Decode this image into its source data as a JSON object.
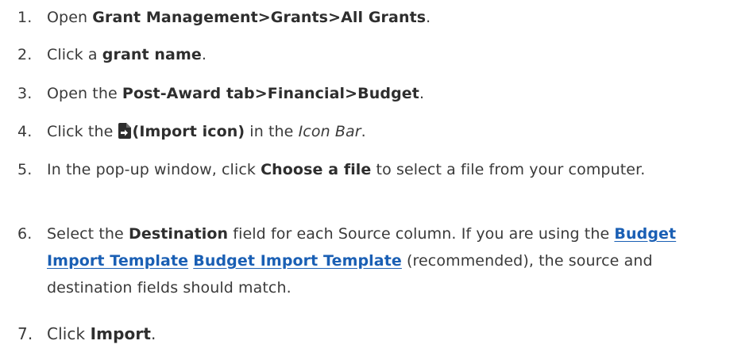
{
  "steps": [
    {
      "number": "1.",
      "pre": "Open ",
      "bold": "Grant Management>Grants>All Grants",
      "post": "."
    },
    {
      "number": "2.",
      "pre": "Click a ",
      "bold": "grant name",
      "post": "."
    },
    {
      "number": "3.",
      "pre": "Open the ",
      "bold": "Post-Award tab>Financial>Budget",
      "post": "."
    },
    {
      "number": "4.",
      "pre": "Click the ",
      "icon": "import-file-icon",
      "bold": "(Import icon)",
      "mid": " in the ",
      "italic": "Icon Bar",
      "post": "."
    },
    {
      "number": "5.",
      "pre": "In the pop-up window, click ",
      "bold": "Choose a file",
      "post": " to select a file from your computer."
    },
    {
      "number": "6.",
      "pre": "Select the ",
      "bold": "Destination",
      "mid": " field for each Source column. If you are using the ",
      "link1": "Budget Import Template",
      "link2": "Budget Import Template",
      "post": " (recommended), the source and destination fields should match."
    },
    {
      "number": "7.",
      "pre": "Click ",
      "bold": "Import",
      "post": "."
    }
  ],
  "colors": {
    "text": "#3a3a3a",
    "link": "#1a5fb4"
  }
}
